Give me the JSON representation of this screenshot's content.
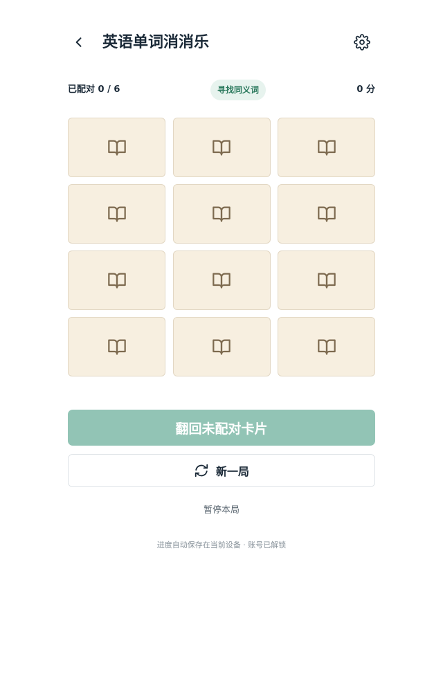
{
  "header": {
    "title": "英语单词消消乐",
    "back_icon": "chevron-left-icon",
    "settings_icon": "gear-icon"
  },
  "status": {
    "matched": "已配对 0 / 6",
    "mode": "寻找同义词",
    "score": "0 分"
  },
  "cards": [
    {
      "icon": "book-open-icon"
    },
    {
      "icon": "book-open-icon"
    },
    {
      "icon": "book-open-icon"
    },
    {
      "icon": "book-open-icon"
    },
    {
      "icon": "book-open-icon"
    },
    {
      "icon": "book-open-icon"
    },
    {
      "icon": "book-open-icon"
    },
    {
      "icon": "book-open-icon"
    },
    {
      "icon": "book-open-icon"
    },
    {
      "icon": "book-open-icon"
    },
    {
      "icon": "book-open-icon"
    },
    {
      "icon": "book-open-icon"
    }
  ],
  "actions": {
    "flip_back_label": "翻回未配对卡片",
    "new_game_label": "新一局",
    "pause_label": "暂停本局"
  },
  "footer": {
    "note": "进度自动保存在当前设备 · 账号已解锁"
  },
  "colors": {
    "accent": "#92c4b5",
    "badge_bg": "#e7f3ee",
    "badge_text": "#2c7a5e",
    "card_bg": "#f7efe0",
    "card_icon": "#7d6a4f"
  }
}
